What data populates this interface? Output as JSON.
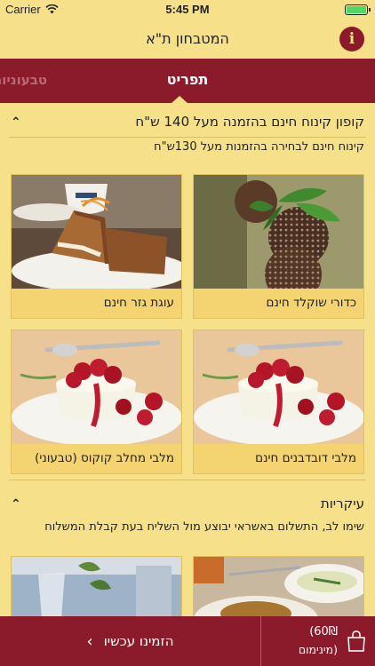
{
  "status": {
    "carrier": "Carrier",
    "time": "5:45 PM"
  },
  "nav": {
    "title": "המטבחון ת\"א"
  },
  "tabs": {
    "active": "תפריט",
    "other": "טבעוניות"
  },
  "section1": {
    "title": "קופון קינוח חינם בהזמנה מעל 140 ש\"ח",
    "subtitle": "קינוח חינם לבחירה בהזמנות מעל 130ש\"ח"
  },
  "cards": [
    {
      "label": "כדורי שוקלד חינם"
    },
    {
      "label": "עוגת גזר חינם"
    },
    {
      "label": "מלבי דובדבנים חינם"
    },
    {
      "label": "מלבי מחלב קוקוס (טבעוני)"
    }
  ],
  "section2": {
    "title": "עיקריות",
    "subtitle": "שימו לב, התשלום באשראי יבוצע מול השליח בעת קבלת המשלוח"
  },
  "bottom": {
    "order_label": "הזמינו עכשיו",
    "price": "(60₪",
    "minimum": "מינימום)"
  },
  "colors": {
    "accent": "#8b1a2b",
    "background": "#f7e08a",
    "card": "#f4d471"
  }
}
